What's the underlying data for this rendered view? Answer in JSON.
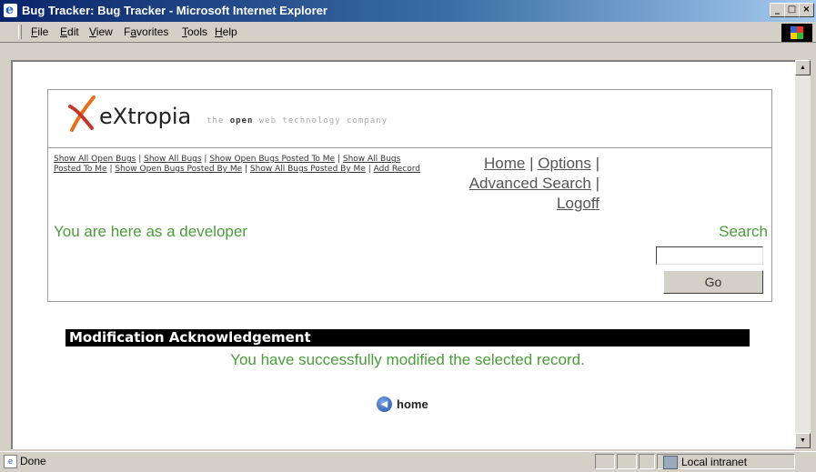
{
  "window": {
    "title": "Bug Tracker: Bug Tracker - Microsoft Internet Explorer",
    "controls": [
      "_",
      "□",
      "×"
    ]
  },
  "menu": {
    "items": [
      {
        "accel": "F",
        "rest": "ile"
      },
      {
        "accel": "E",
        "rest": "dit"
      },
      {
        "accel": "V",
        "rest": "iew"
      },
      {
        "pre": "F",
        "accel": "a",
        "rest": "vorites"
      },
      {
        "accel": "T",
        "rest": "ools"
      },
      {
        "accel": "H",
        "rest": "elp"
      }
    ]
  },
  "header": {
    "logo_text": "eXtropia",
    "tagline_pre": "the ",
    "tagline_bold": "open",
    "tagline_post": " web technology company"
  },
  "nav_small": [
    "Show All Open Bugs",
    "Show All Bugs",
    "Show Open Bugs Posted To Me",
    "Show All Bugs Posted To Me",
    "Show Open Bugs Posted By Me",
    "Show All Bugs Posted By Me",
    "Add Record"
  ],
  "nav_large": {
    "home": "Home",
    "options": "Options",
    "advanced_search": "Advanced Search",
    "logoff": "Logoff"
  },
  "role_text": "You are here as a developer",
  "search": {
    "label": "Search",
    "value": "",
    "button": "Go"
  },
  "acknowledgement": {
    "heading": "Modification Acknowledgement",
    "message": "You have successfully modified the selected record."
  },
  "home_link": "home",
  "status": {
    "text": "Done",
    "zone": "Local intranet"
  },
  "colors": {
    "title_gradient_start": "#0a246a",
    "accent_green": "#4a9c3a",
    "logo_orange": "#e8701a"
  }
}
